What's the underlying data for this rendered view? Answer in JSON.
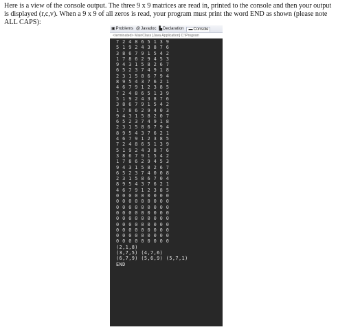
{
  "instructions": "Here is a view of the console output. The three 9 x 9 matrices are read in, printed to the console and then your output is displayed (r,c,v). When a 9 x 9 of all zeros is read, your program must print the word END as shown (please note ALL CAPS):",
  "console": {
    "tabs": [
      {
        "icon": "problems-icon",
        "glyph": "▣",
        "label": "Problems"
      },
      {
        "icon": "javadoc-icon",
        "glyph": "@",
        "label": "Javadoc"
      },
      {
        "icon": "declaration-icon",
        "glyph": "▙",
        "label": "Declaration"
      },
      {
        "icon": "console-icon",
        "glyph": "▬",
        "label": "Console"
      }
    ],
    "status": "<terminated> MainClass [Java Application] C:\\Program",
    "lines": [
      "7 2 4 8 6 5 1 3 9",
      "5 1 9 2 4 3 8 7 6",
      "3 8 6 7 9 1 5 4 2",
      "1 7 8 6 2 9 4 5 3",
      "9 4 3 1 5 8 2 6 7",
      "6 5 2 3 7 4 9 1 8",
      "2 3 1 5 8 6 7 9 4",
      "8 9 5 4 3 7 6 2 1",
      "4 6 7 9 1 2 3 8 5",
      "7 2 4 8 6 5 1 3 9",
      "5 1 9 2 4 3 8 7 6",
      "3 8 6 7 9 1 5 4 2",
      "1 7 8 6 2 9 4 0 3",
      "9 4 3 1 5 8 2 0 7",
      "6 5 2 3 7 4 9 1 8",
      "2 3 1 5 8 6 7 9 4",
      "8 9 5 4 3 7 6 2 1",
      "4 6 7 9 1 2 3 8 5",
      "7 2 4 8 6 5 1 3 9",
      "5 1 9 2 4 3 8 7 6",
      "3 8 6 7 9 1 5 4 2",
      "1 7 8 6 2 9 4 5 3",
      "9 4 3 1 5 8 2 6 7",
      "6 5 2 3 7 4 0 0 8",
      "2 3 1 5 8 6 7 0 4",
      "8 9 5 4 3 7 6 2 1",
      "4 6 7 9 1 2 3 8 5",
      "0 0 0 0 0 0 0 0 0",
      "0 0 0 0 0 0 0 0 0",
      "0 0 0 0 0 0 0 0 0",
      "0 0 0 0 0 0 0 0 0",
      "0 0 0 0 0 0 0 0 0",
      "0 0 0 0 0 0 0 0 0",
      "0 0 0 0 0 0 0 0 0",
      "0 0 0 0 0 0 0 0 0",
      "0 0 0 0 0 0 0 0 0"
    ],
    "results": [
      "(2,1,8)",
      "(3,7,5) (4,7,6)",
      "(6,7,9) (5,6,9) (5,7,1)",
      "END"
    ]
  }
}
